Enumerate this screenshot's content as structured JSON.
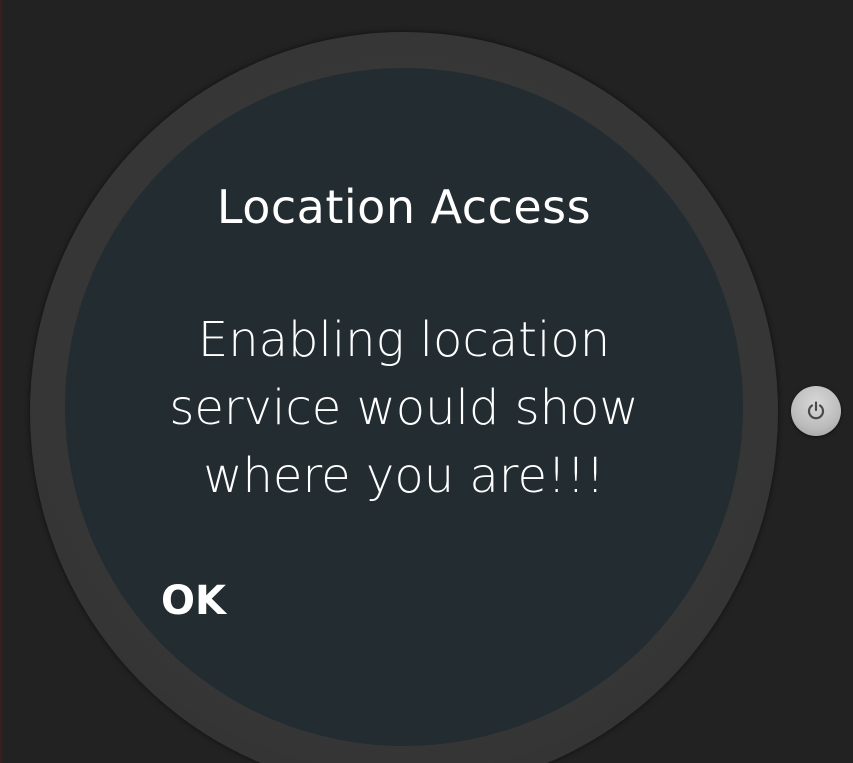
{
  "dialog": {
    "title": "Location Access",
    "message": "Enabling location service would show where you are!!!",
    "ok_label": "OK"
  },
  "device": {
    "power_icon": "power-icon",
    "screen_color": "#222c31",
    "bezel_color": "#353535",
    "background_color": "#222222"
  }
}
